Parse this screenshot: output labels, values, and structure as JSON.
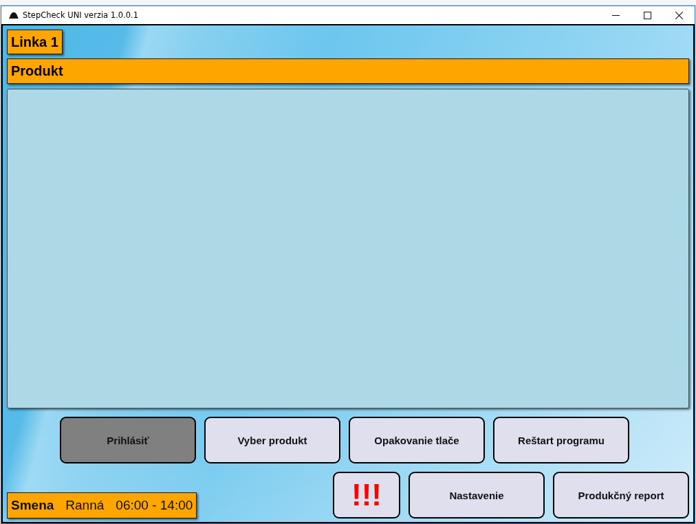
{
  "window": {
    "title": "StepCheck UNI verzia 1.0.0.1"
  },
  "line": {
    "label": "Linka 1"
  },
  "product": {
    "label": "Produkt"
  },
  "buttons_top": [
    {
      "label": "Prihlásiť",
      "kind": "text",
      "disabled": true
    },
    {
      "label": "Vyber produkt",
      "kind": "text",
      "disabled": false
    },
    {
      "label": "Opakovanie tlače",
      "kind": "text",
      "disabled": false
    },
    {
      "label": "Reštart programu",
      "kind": "text",
      "disabled": false
    }
  ],
  "buttons_bottom": [
    {
      "label": "!!!",
      "kind": "alert",
      "disabled": false
    },
    {
      "label": "Nastavenie",
      "kind": "text",
      "disabled": false
    },
    {
      "label": "Produkčný report",
      "kind": "text",
      "disabled": false
    }
  ],
  "shift": {
    "label": "Smena",
    "name": "Ranná",
    "time": "06:00 - 14:00"
  }
}
